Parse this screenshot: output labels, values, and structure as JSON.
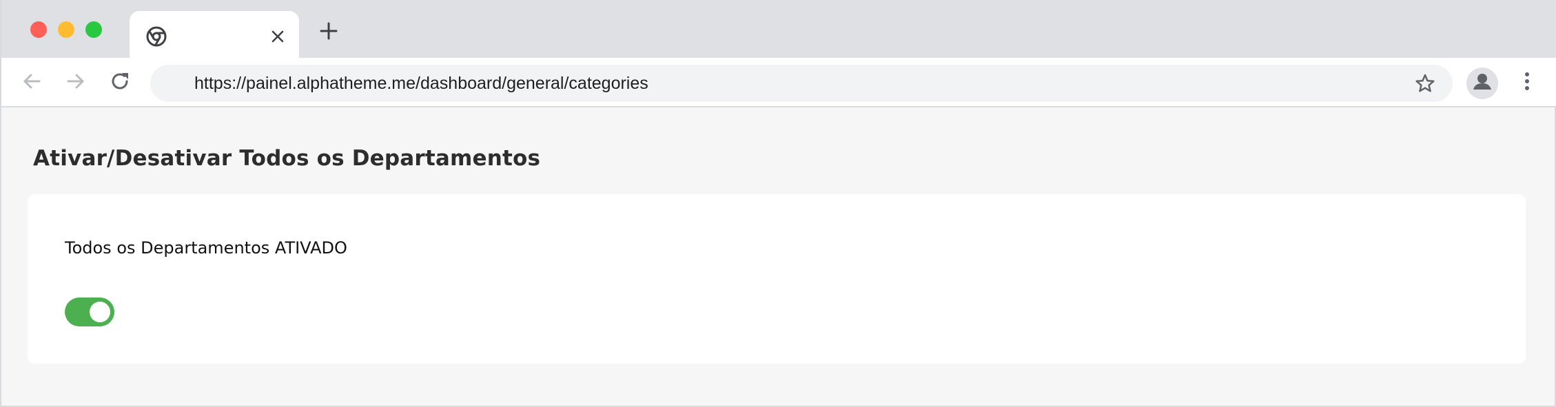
{
  "browser": {
    "tab": {
      "favicon": "chrome-icon",
      "title": "",
      "close_icon": "close-icon"
    },
    "new_tab_icon": "plus-icon",
    "nav": {
      "back_icon": "arrow-left-icon",
      "forward_icon": "arrow-right-icon",
      "reload_icon": "reload-icon"
    },
    "url": "https://painel.alphatheme.me/dashboard/general/categories",
    "bookmark_icon": "star-icon",
    "profile_icon": "person-icon",
    "menu_icon": "kebab-menu-icon"
  },
  "main": {
    "title": "Ativar/Desativar Todos os Departamentos",
    "card": {
      "status_label": "Todos os Departamentos ATIVADO",
      "toggle": {
        "on": true,
        "color": "#4caf50"
      }
    }
  }
}
